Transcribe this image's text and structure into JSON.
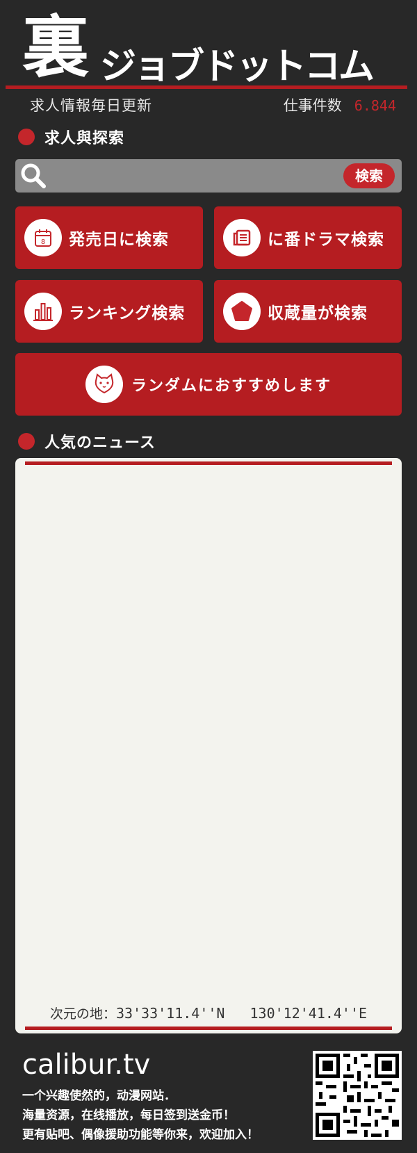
{
  "header": {
    "logo_kanji": "裏",
    "logo_kana": "ジョブドットコム",
    "tagline": "求人情報毎日更新",
    "jobs_label": "仕事件数",
    "jobs_count": "6.844"
  },
  "search_section": {
    "title": "求人與探索",
    "search_placeholder": "",
    "search_button": "検索"
  },
  "tiles": {
    "release_date": "発売日に検索",
    "drama": "に番ドラマ検索",
    "ranking": "ランキング検索",
    "favorites": "収蔵量が検索",
    "random": "ランダムにおすすめします"
  },
  "calendar_icon_day": "8",
  "news_section": {
    "title": "人気のニュース",
    "coords_label": "次元の地：",
    "lat": "33'33'11.4''N",
    "lon": "130'12'41.4''E"
  },
  "footer": {
    "site": "calibur.tv",
    "line1": "一个兴趣使然的，动漫网站．",
    "line2": "海量资源，在线播放，每日签到送金币！",
    "line3": "更有贴吧、偶像援助功能等你来，欢迎加入！"
  },
  "colors": {
    "background": "#282828",
    "accent": "#b51d21",
    "search_bar": "#8a8a8a",
    "news_panel": "#f3f3ee"
  },
  "icons": [
    "search-icon",
    "calendar-icon",
    "news-icon",
    "bar-chart-icon",
    "pentagon-icon",
    "cat-icon",
    "qr-code-icon"
  ]
}
